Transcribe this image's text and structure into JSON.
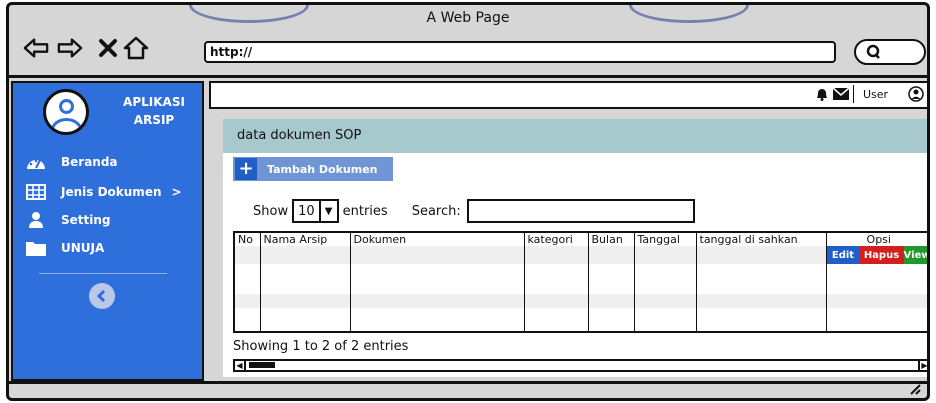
{
  "window": {
    "title": "A Web Page"
  },
  "browser": {
    "back_icon": "back-arrow-icon",
    "forward_icon": "forward-arrow-icon",
    "stop_icon": "close-icon",
    "home_icon": "home-icon",
    "url": "http://",
    "search_icon": "search-icon"
  },
  "sidebar": {
    "app_name_line1": "APLIKASI",
    "app_name_line2": "ARSIP",
    "items": [
      {
        "label": "Beranda",
        "icon": "dashboard-icon"
      },
      {
        "label": "Jenis Dokumen",
        "icon": "table-icon",
        "suffix": ">"
      },
      {
        "label": "Setting",
        "icon": "user-icon"
      },
      {
        "label": "UNUJA",
        "icon": "folder-icon"
      }
    ],
    "collapse_icon": "chevron-left-circle-icon",
    "color": "#2f6fdc"
  },
  "topbar": {
    "user_label": "User"
  },
  "panel": {
    "heading": "data dokumen SOP",
    "add_button": "Tambah Dokumen",
    "show_label": "Show",
    "entries_value": "10",
    "entries_label": "entries",
    "search_label": "Search:",
    "columns": [
      "No",
      "Nama Arsip",
      "Dokumen",
      "kategori",
      "Bulan",
      "Tanggal",
      "tanggal di sahkan",
      "Opsi"
    ],
    "actions": {
      "edit": "Edit",
      "delete": "Hapus",
      "view": "View"
    },
    "info": "Showing 1 to 2 of 2 entries"
  }
}
